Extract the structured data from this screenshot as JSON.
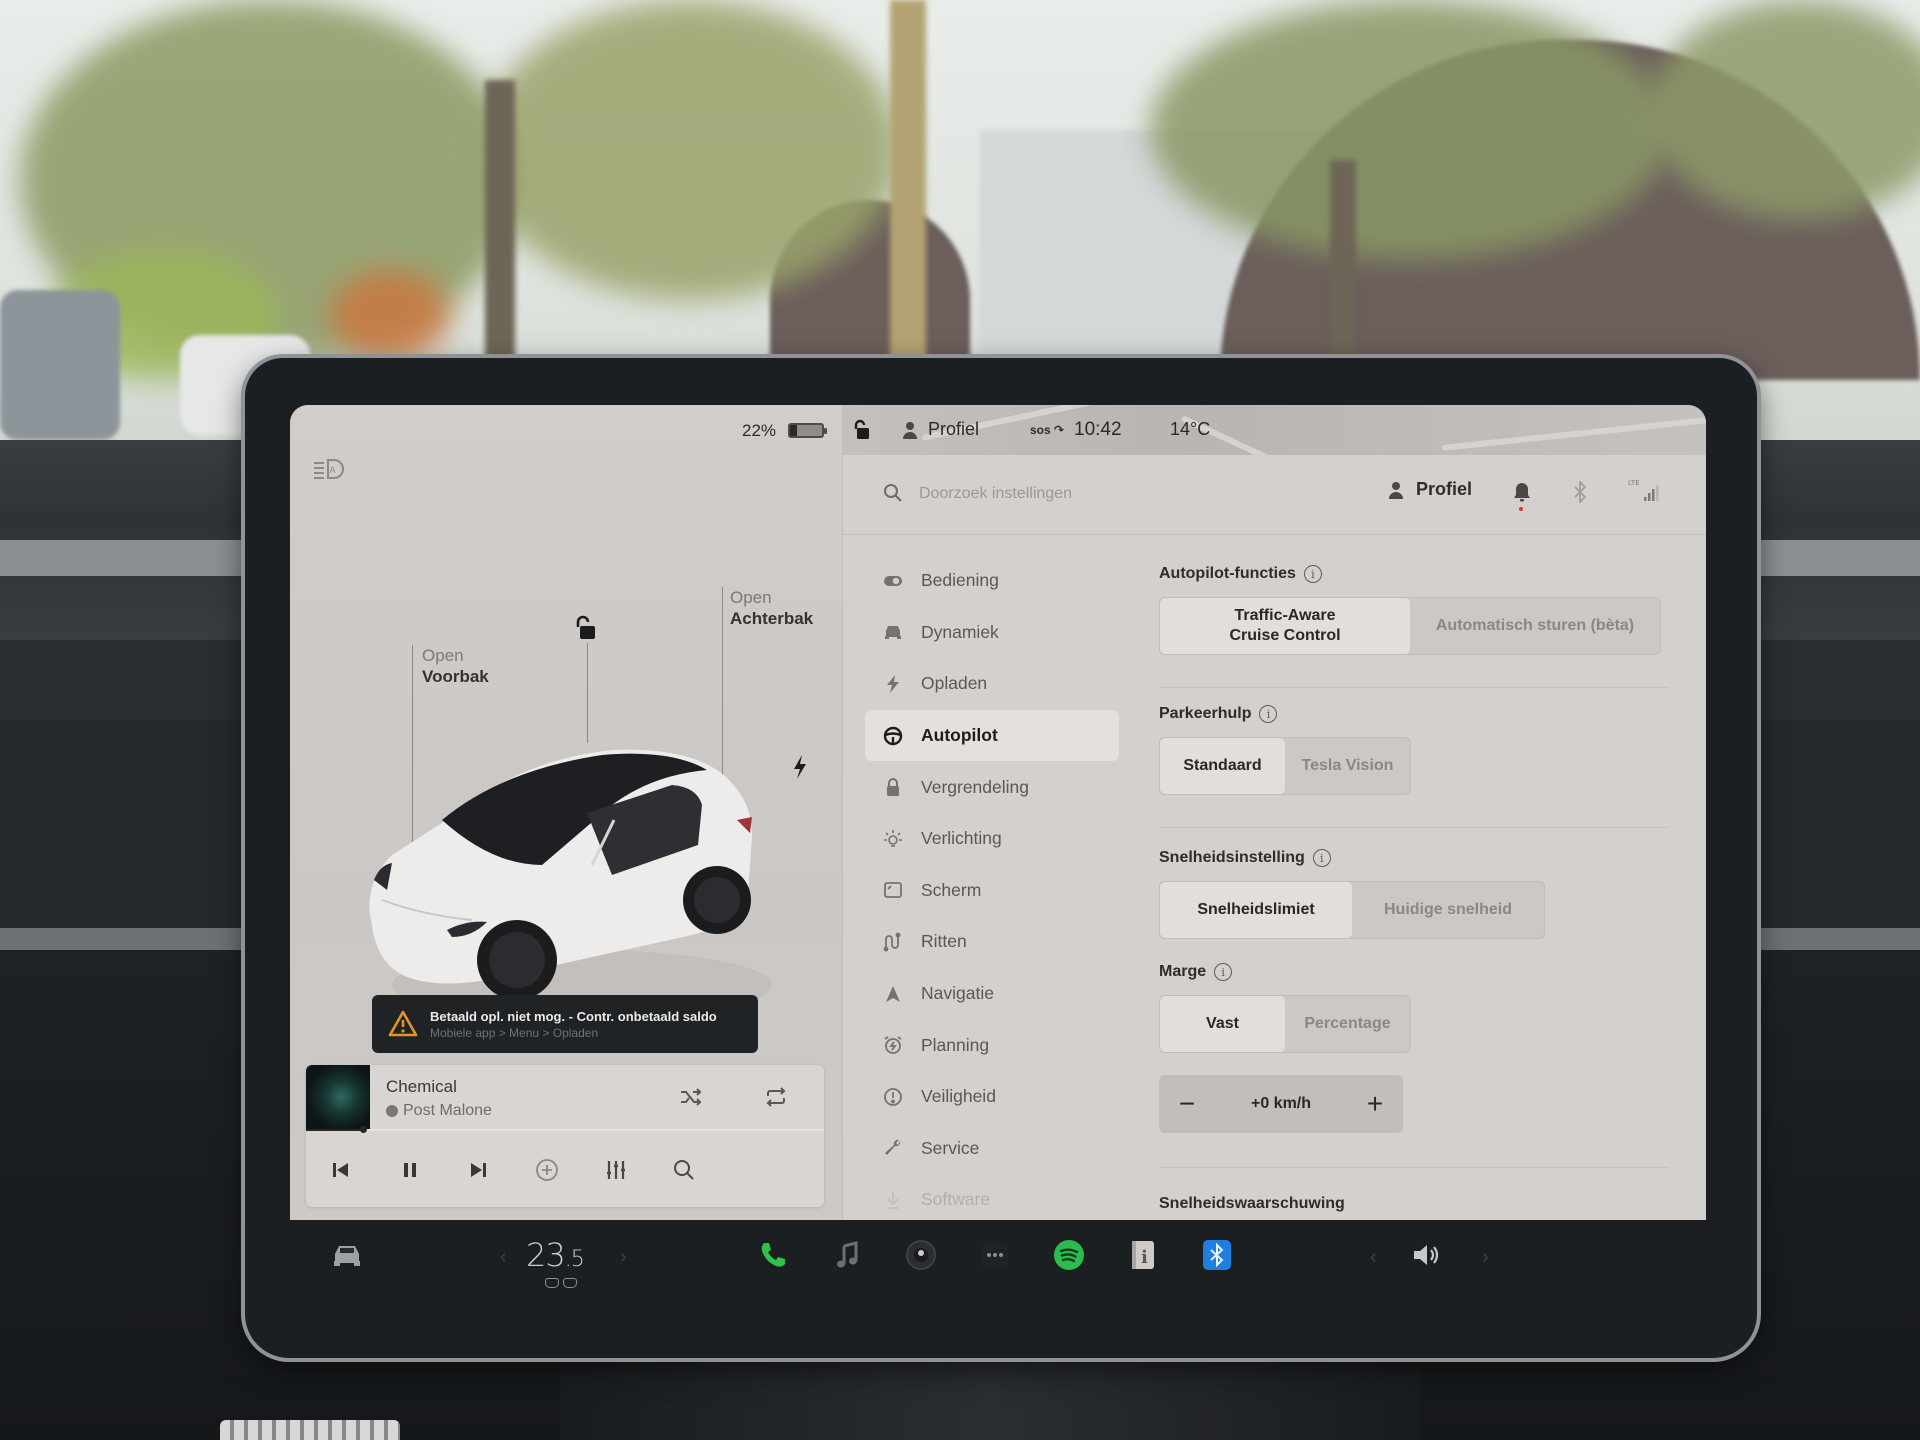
{
  "status_bar": {
    "battery_percent_label": "22%",
    "battery_level": 0.22,
    "lock_state_icon": "unlocked-icon",
    "profile_label": "Profiel",
    "sos_label": "sos",
    "time": "10:42",
    "outside_temp": "14°C"
  },
  "car_view": {
    "frunk": {
      "line1": "Open",
      "line2": "Voorbak"
    },
    "trunk": {
      "line1": "Open",
      "line2": "Achterbak"
    },
    "headlight_icon": "auto-headlights-icon",
    "charge_port_icon": "lightning-icon"
  },
  "alert": {
    "title": "Betaald opl. niet mog. - Contr. onbetaald saldo",
    "subtitle": "Mobiele app > Menu > Opladen",
    "icon": "warning-icon",
    "accent": "#e8912b"
  },
  "media": {
    "track_title": "Chemical",
    "artist": "Post Malone",
    "source_icon": "spotify-icon",
    "progress": 0.11,
    "controls": [
      "previous",
      "pause",
      "next",
      "add",
      "equalizer",
      "search"
    ]
  },
  "settings_header": {
    "search_placeholder": "Doorzoek instellingen",
    "search_value": "",
    "profile_label": "Profiel",
    "notification_dot_color": "#d6383f",
    "lte_label": "LTE"
  },
  "menu": {
    "items": [
      {
        "label": "Bediening",
        "icon": "toggle-icon",
        "active": false
      },
      {
        "label": "Dynamiek",
        "icon": "car-icon",
        "active": false
      },
      {
        "label": "Opladen",
        "icon": "lightning-icon",
        "active": false
      },
      {
        "label": "Autopilot",
        "icon": "steering-wheel-icon",
        "active": true
      },
      {
        "label": "Vergrendeling",
        "icon": "lock-icon",
        "active": false
      },
      {
        "label": "Verlichting",
        "icon": "light-bulb-icon",
        "active": false
      },
      {
        "label": "Scherm",
        "icon": "display-icon",
        "active": false
      },
      {
        "label": "Ritten",
        "icon": "trips-icon",
        "active": false
      },
      {
        "label": "Navigatie",
        "icon": "navigation-arrow-icon",
        "active": false
      },
      {
        "label": "Planning",
        "icon": "alarm-clock-icon",
        "active": false
      },
      {
        "label": "Veiligheid",
        "icon": "alert-circle-icon",
        "active": false
      },
      {
        "label": "Service",
        "icon": "wrench-icon",
        "active": false
      },
      {
        "label": "Software",
        "icon": "download-icon",
        "active": false
      }
    ]
  },
  "autopilot": {
    "features": {
      "label": "Autopilot-functies",
      "options": [
        "Traffic-Aware\nCruise Control",
        "Automatisch sturen (bèta)"
      ],
      "selected": 0
    },
    "park_assist": {
      "label": "Parkeerhulp",
      "options": [
        "Standaard",
        "Tesla Vision"
      ],
      "selected": 0
    },
    "speed_setting": {
      "label": "Snelheidsinstelling",
      "options": [
        "Snelheidslimiet",
        "Huidige snelheid"
      ],
      "selected": 0
    },
    "offset": {
      "label": "Marge",
      "options": [
        "Vast",
        "Percentage"
      ],
      "selected": 0,
      "value": "+0 km/h",
      "minus": "−",
      "plus": "+"
    },
    "speed_warning": {
      "label": "Snelheidswaarschuwing"
    }
  },
  "dock": {
    "cabin_temp_int": "23",
    "cabin_temp_dec": ".5",
    "apps": [
      {
        "name": "phone",
        "color": "#2fc24a"
      },
      {
        "name": "music",
        "color": "#6b6f73"
      },
      {
        "name": "camera",
        "color": "#3a3d41"
      },
      {
        "name": "more",
        "color": "#6b6f73"
      },
      {
        "name": "spotify",
        "color": "#2dba4e"
      },
      {
        "name": "manual",
        "color": "#c9c6c2"
      },
      {
        "name": "bluetooth",
        "color": "#1f7fe0"
      }
    ],
    "volume_icon": "volume-icon"
  }
}
